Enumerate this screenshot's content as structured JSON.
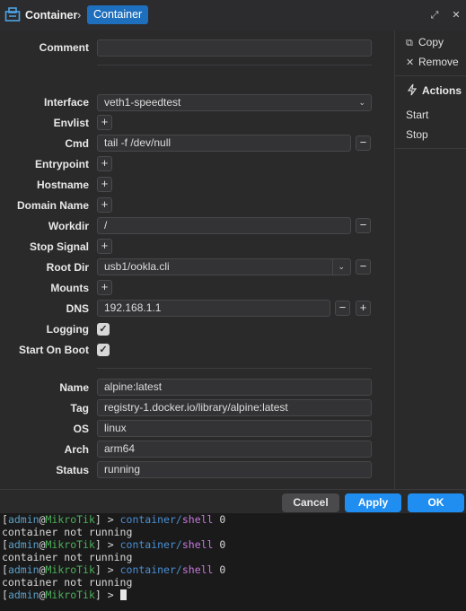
{
  "titlebar": {
    "breadcrumb_root": "Container",
    "breadcrumb_sep": "›",
    "breadcrumb_current": "Container",
    "restore_icon": "restore-icon",
    "close_icon": "close-icon"
  },
  "form": {
    "comment_label": "Comment",
    "comment_value": "",
    "interface_label": "Interface",
    "interface_value": "veth1-speedtest",
    "envlist_label": "Envlist",
    "cmd_label": "Cmd",
    "cmd_value": "tail -f /dev/null",
    "entrypoint_label": "Entrypoint",
    "hostname_label": "Hostname",
    "domain_label": "Domain Name",
    "workdir_label": "Workdir",
    "workdir_value": "/",
    "stop_signal_label": "Stop Signal",
    "root_dir_label": "Root Dir",
    "root_dir_value": "usb1/ookla.cli",
    "mounts_label": "Mounts",
    "dns_label": "DNS",
    "dns_value": "192.168.1.1",
    "logging_label": "Logging",
    "logging_checked": true,
    "start_on_boot_label": "Start On Boot",
    "start_on_boot_checked": true,
    "name_label": "Name",
    "name_value": "alpine:latest",
    "tag_label": "Tag",
    "tag_value": "registry-1.docker.io/library/alpine:latest",
    "os_label": "OS",
    "os_value": "linux",
    "arch_label": "Arch",
    "arch_value": "arm64",
    "status_label": "Status",
    "status_value": "running",
    "plus": "+",
    "minus": "−",
    "check": "✓",
    "chevron": "⌄"
  },
  "sidebar": {
    "copy_label": "Copy",
    "remove_label": "Remove",
    "actions_title": "Actions",
    "start_label": "Start",
    "stop_label": "Stop"
  },
  "footer": {
    "cancel_label": "Cancel",
    "apply_label": "Apply",
    "ok_label": "OK"
  },
  "terminal": {
    "user": "admin",
    "host": "MikroTik",
    "prompt_open": "[",
    "prompt_close": "] > ",
    "cmd_path": "container/",
    "cmd_sub": "shell",
    "cmd_arg": " 0",
    "message": "container not running"
  }
}
